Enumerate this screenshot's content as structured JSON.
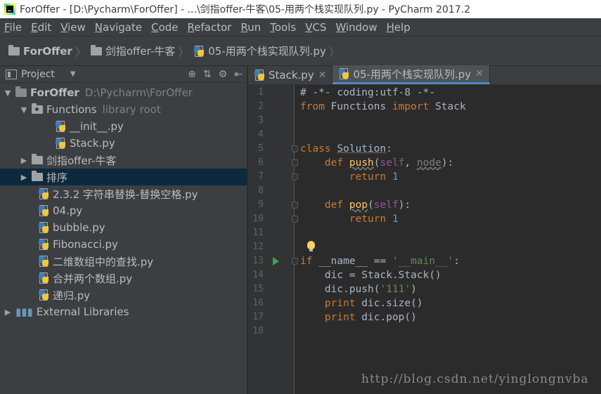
{
  "window": {
    "title": "ForOffer - [D:\\Pycharm\\ForOffer] - ...\\剑指offer-牛客\\05-用两个栈实现队列.py - PyCharm 2017.2"
  },
  "menu": [
    "File",
    "Edit",
    "View",
    "Navigate",
    "Code",
    "Refactor",
    "Run",
    "Tools",
    "VCS",
    "Window",
    "Help"
  ],
  "breadcrumb": [
    "ForOffer",
    "剑指offer-牛客",
    "05-用两个栈实现队列.py"
  ],
  "project_panel": {
    "title": "Project",
    "root": {
      "name": "ForOffer",
      "path": "D:\\Pycharm\\ForOffer"
    },
    "functions": {
      "name": "Functions",
      "note": "library root"
    },
    "functions_files": [
      "__init__.py",
      "Stack.py"
    ],
    "folders": [
      "剑指offer-牛客",
      "排序"
    ],
    "files": [
      "2.3.2 字符串替换-替换空格.py",
      "04.py",
      "bubble.py",
      "Fibonacci.py",
      "二维数组中的查找.py",
      "合并两个数组.py",
      "递归.py"
    ],
    "external": "External Libraries"
  },
  "tabs": [
    "Stack.py",
    "05-用两个栈实现队列.py"
  ],
  "code": {
    "line_numbers": [
      "1",
      "2",
      "3",
      "4",
      "5",
      "6",
      "7",
      "8",
      "9",
      "10",
      "11",
      "12",
      "13",
      "14",
      "15",
      "16",
      "17",
      "18"
    ],
    "l1": "# -*- coding:utf-8 -*-",
    "l2_from": "from",
    "l2_mod": " Functions ",
    "l2_import": "import",
    "l2_name": " Stack",
    "l5_class": "class",
    "l5_name": "Solution",
    "l5_colon": ":",
    "l6_def": "def",
    "l6_fn": "push",
    "l6_open": "(",
    "l6_self": "self",
    "l6_rest": ", ",
    "l6_node": "node",
    "l6_close": "):",
    "l7_ret": "return",
    "l7_val": "1",
    "l9_def": "def",
    "l9_fn": "pop",
    "l9_open": "(",
    "l9_self": "self",
    "l9_close": "):",
    "l10_ret": "return",
    "l10_val": "1",
    "l13_if": "if",
    "l13_name": "__name__",
    "l13_eq": " == ",
    "l13_str": "'__main__'",
    "l13_colon": ":",
    "l14": "dic = Stack.Stack()",
    "l15_pre": "dic.push(",
    "l15_str": "'111'",
    "l15_post": ")",
    "l16_print": "print",
    "l16_rest": " dic.size()",
    "l17_print": "print",
    "l17_rest": " dic.pop()"
  },
  "watermark": "http://blog.csdn.net/yinglongnvba"
}
